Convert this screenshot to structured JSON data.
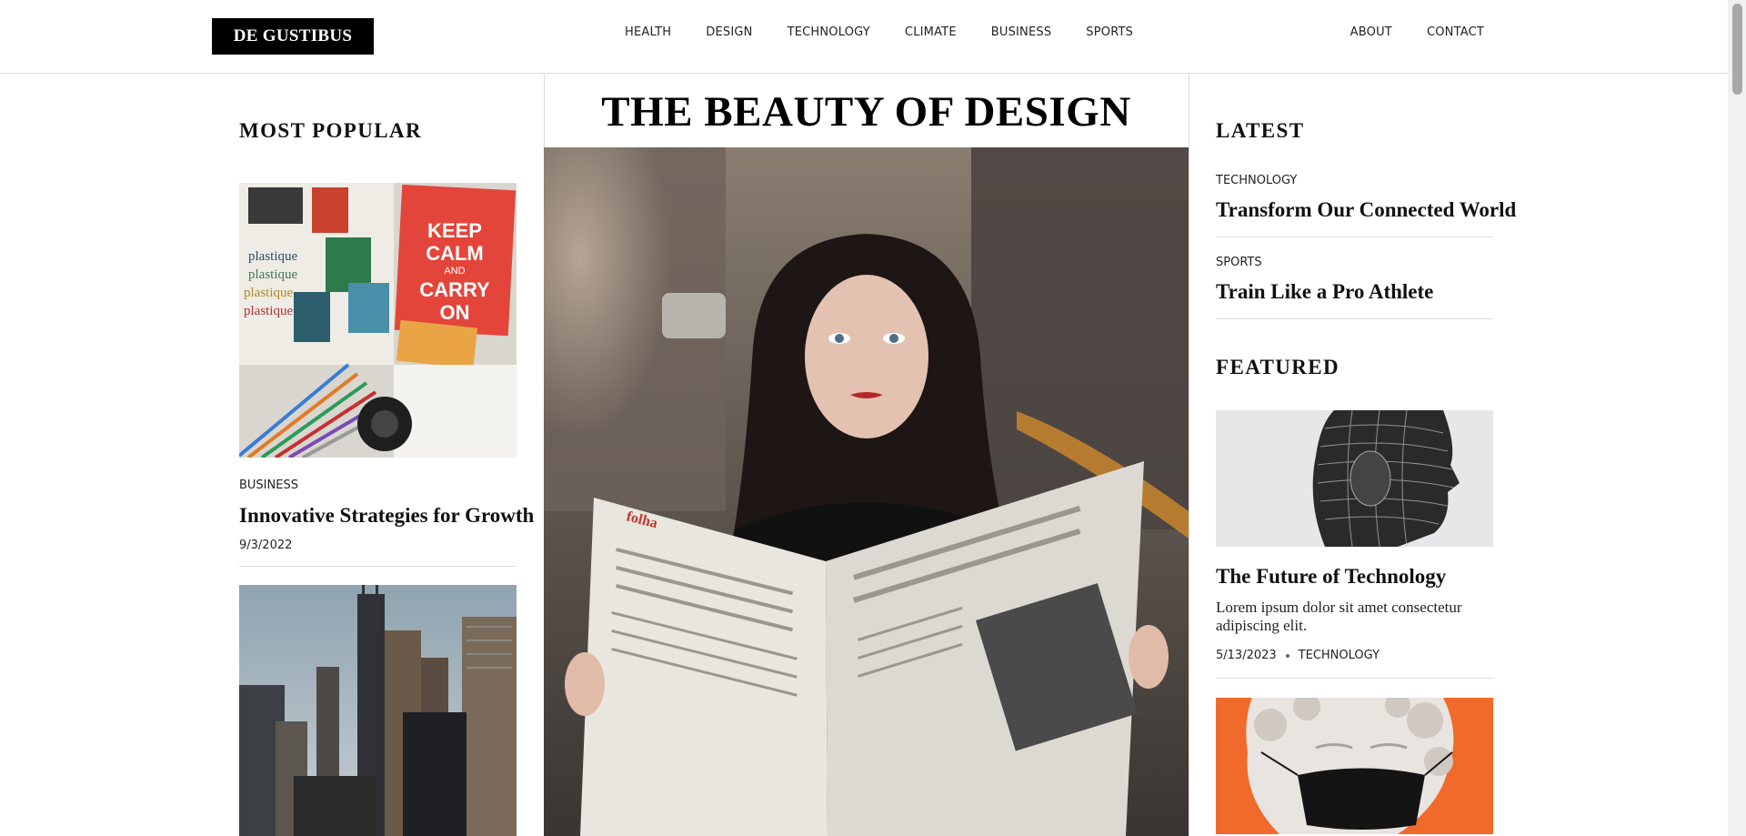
{
  "header": {
    "logo": "DE GUSTIBUS",
    "nav": [
      "HEALTH",
      "DESIGN",
      "TECHNOLOGY",
      "CLIMATE",
      "BUSINESS",
      "SPORTS"
    ],
    "nav_right": [
      "ABOUT",
      "CONTACT"
    ]
  },
  "popular": {
    "heading": "MOST POPULAR",
    "items": [
      {
        "category": "BUSINESS",
        "title": "Innovative Strategies for Growth",
        "date": "9/3/2022"
      }
    ]
  },
  "hero": {
    "title": "THE BEAUTY OF DESIGN"
  },
  "latest": {
    "heading": "LATEST",
    "items": [
      {
        "category": "TECHNOLOGY",
        "title": "Transform Our Connected World"
      },
      {
        "category": "SPORTS",
        "title": "Train Like a Pro Athlete"
      }
    ]
  },
  "featured": {
    "heading": "FEATURED",
    "items": [
      {
        "title": "The Future of Technology",
        "excerpt": "Lorem ipsum dolor sit amet consectetur adipiscing elit.",
        "date": "5/13/2023",
        "category": "TECHNOLOGY"
      }
    ]
  },
  "colors": {
    "logo_bg": "#000000",
    "accent_orange": "#f06a2c",
    "divider": "#dcdcdc"
  }
}
